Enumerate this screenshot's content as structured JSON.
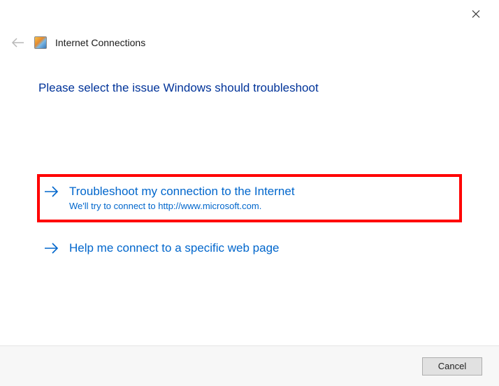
{
  "header": {
    "title": "Internet Connections"
  },
  "page": {
    "heading": "Please select the issue Windows should troubleshoot"
  },
  "options": [
    {
      "title": "Troubleshoot my connection to the Internet",
      "subtitle": "We'll try to connect to http://www.microsoft.com."
    },
    {
      "title": "Help me connect to a specific web page",
      "subtitle": ""
    }
  ],
  "footer": {
    "cancel_label": "Cancel"
  }
}
